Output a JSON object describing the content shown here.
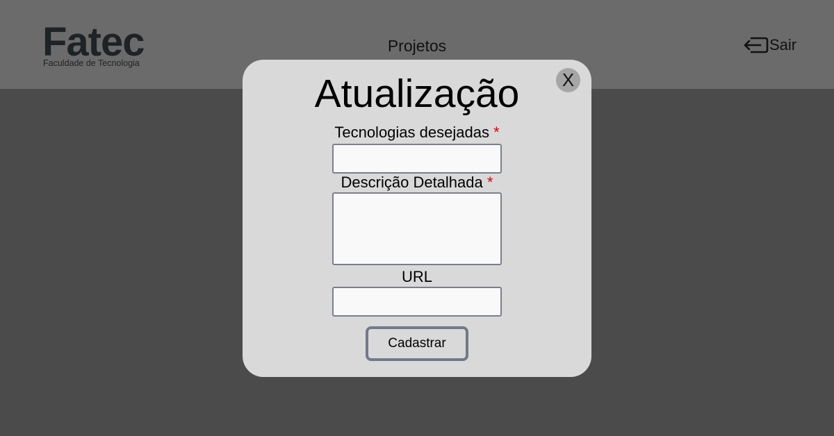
{
  "header": {
    "logo_text": "Fatec",
    "logo_tagline": "Faculdade de Tecnologia",
    "nav_label": "Projetos",
    "logout_label": "Sair",
    "logout_icon": "logout-icon"
  },
  "modal": {
    "title": "Atualização",
    "close_label": "X",
    "fields": [
      {
        "label": "Tecnologias desejadas",
        "required_mark": "*",
        "value": ""
      },
      {
        "label": "Descrição Detalhada",
        "required_mark": "*",
        "value": ""
      },
      {
        "label": "URL",
        "value": ""
      }
    ],
    "submit_label": "Cadastrar"
  },
  "colors": {
    "header_bg": "#6b6b6b",
    "page_bg": "#4b4b4b",
    "modal_bg": "#d9d9d9",
    "required": "#e00000",
    "button_border": "#737987"
  }
}
